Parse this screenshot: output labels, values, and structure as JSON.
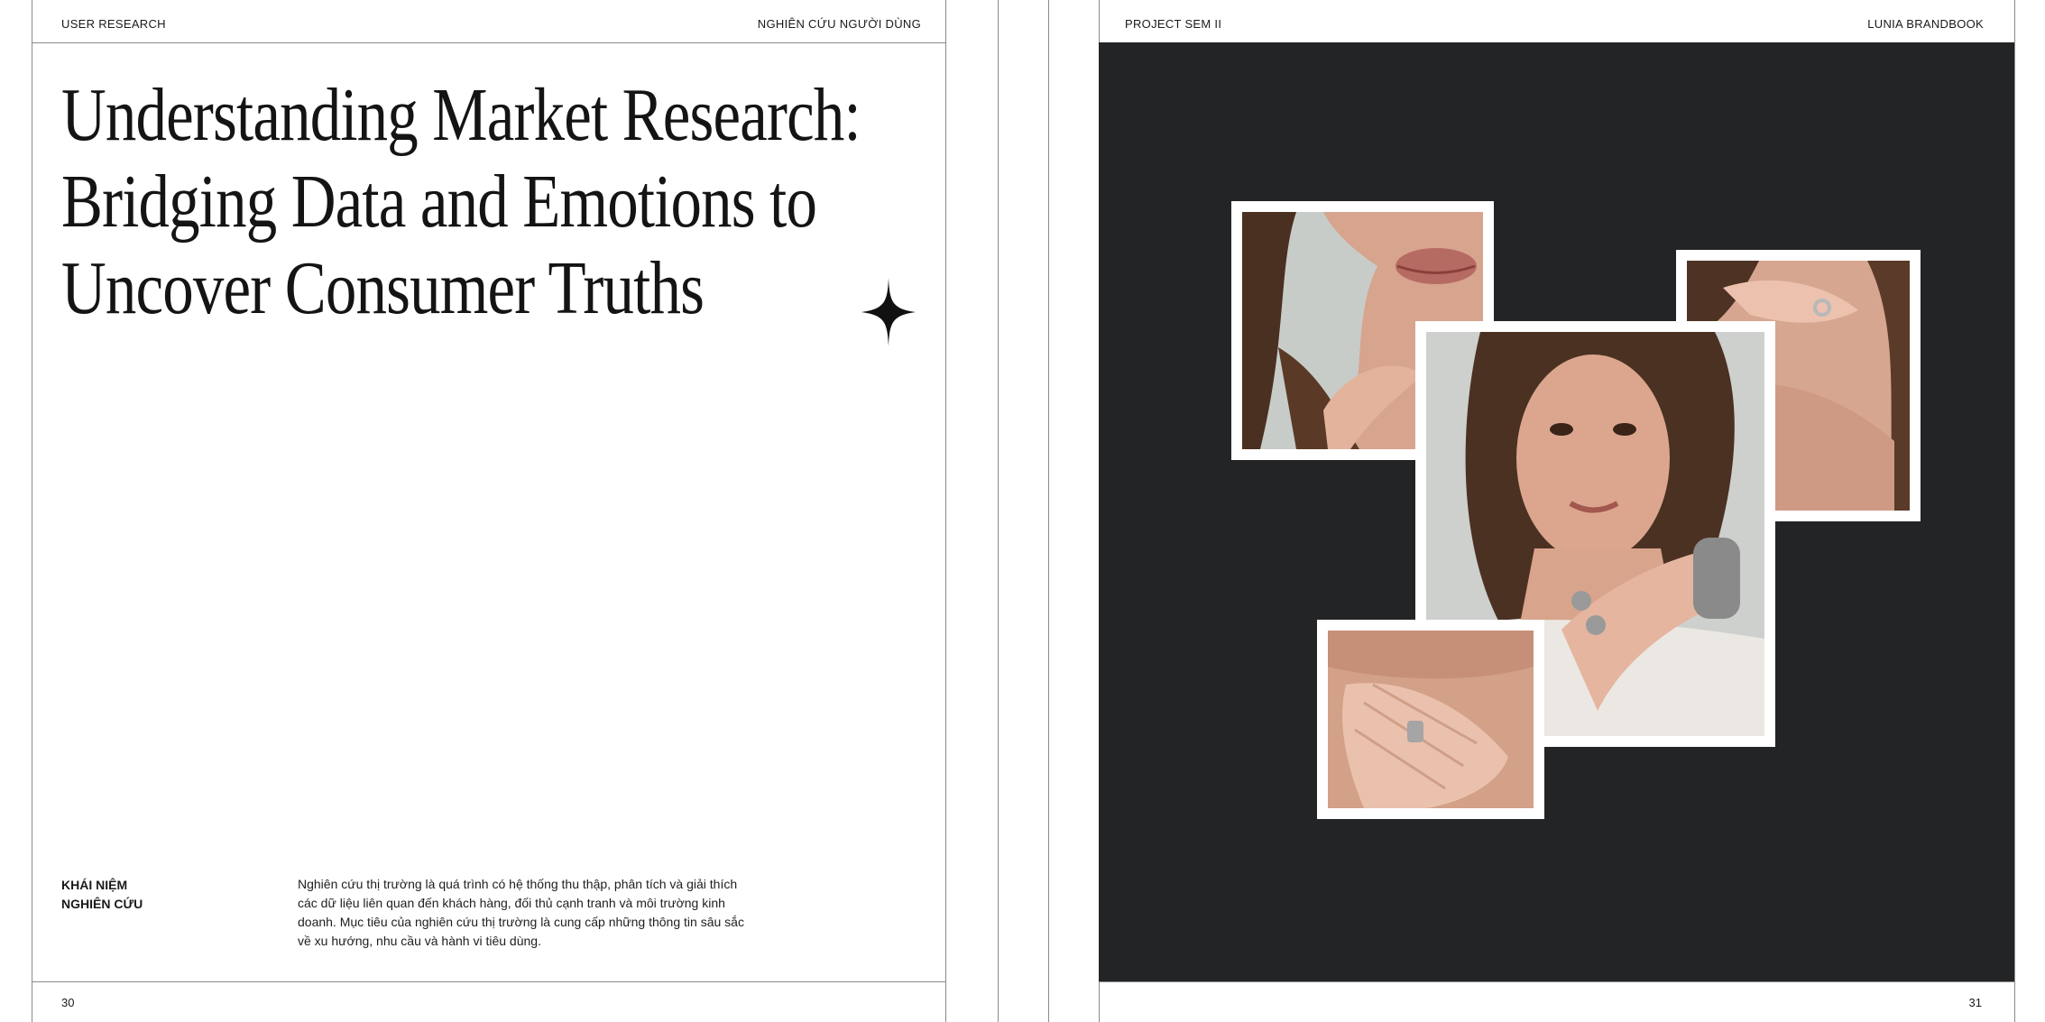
{
  "left_page": {
    "header_left": "USER RESEARCH",
    "header_right": "NGHIÊN CỨU NGƯỜI DÙNG",
    "title_lines": [
      "Understanding Market Research:",
      "Bridging Data and Emotions to",
      "Uncover Consumer Truths"
    ],
    "term_lines": [
      "KHÁI NIỆM",
      "NGHIÊN CỨU"
    ],
    "body_lines": [
      "Nghiên cứu thị trường là quá trình có hệ thống thu thập, phân tích và giải thích",
      "các dữ liệu liên quan đến khách hàng, đối thủ cạnh tranh và môi trường kinh",
      "doanh. Mục tiêu của nghiên cứu thị trường là cung cấp những thông tin sâu sắc",
      "về xu hướng, nhu cầu và hành vi tiêu dùng."
    ],
    "page_number": "30",
    "sparkle_icon": "four-point-star-icon"
  },
  "right_page": {
    "header_left": "PROJECT SEM II",
    "header_right": "LUNIA BRANDBOOK",
    "page_number": "31",
    "panel_color": "#232425",
    "photos": [
      "lips-and-hand-photo",
      "hand-with-ring-on-shoulder-photo",
      "woman-portrait-with-bracelet-photo",
      "hand-on-chest-with-ring-photo"
    ]
  }
}
